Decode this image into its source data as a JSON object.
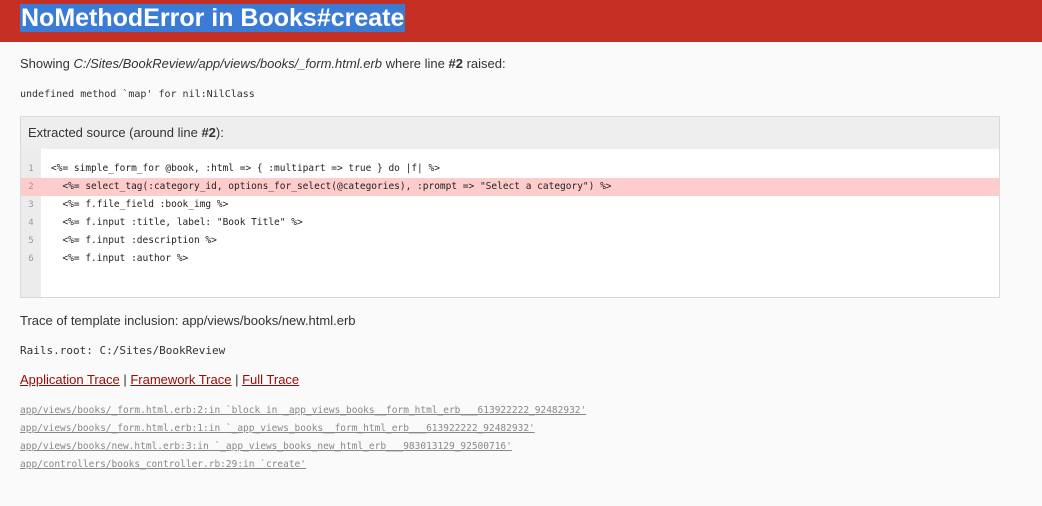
{
  "header": {
    "title": "NoMethodError in Books#create"
  },
  "showing": {
    "prefix": "Showing ",
    "path": "C:/Sites/BookReview/app/views/books/_form.html.erb",
    "middle": " where line ",
    "line": "#2",
    "suffix": " raised:"
  },
  "error_message": "undefined method `map' for nil:NilClass",
  "source": {
    "header_prefix": "Extracted source (around line ",
    "header_line": "#2",
    "header_suffix": "):",
    "highlight_line": 2,
    "lines": [
      {
        "number": "1",
        "code": "<%= simple_form_for @book, :html => { :multipart => true } do |f| %>"
      },
      {
        "number": "2",
        "code": "  <%= select_tag(:category_id, options_for_select(@categories), :prompt => \"Select a category\") %>"
      },
      {
        "number": "3",
        "code": "  <%= f.file_field :book_img %>"
      },
      {
        "number": "4",
        "code": "  <%= f.input :title, label: \"Book Title\" %>"
      },
      {
        "number": "5",
        "code": "  <%= f.input :description %>"
      },
      {
        "number": "6",
        "code": "  <%= f.input :author %>"
      }
    ]
  },
  "trace_inclusion": "Trace of template inclusion: app/views/books/new.html.erb",
  "rails_root": "Rails.root: C:/Sites/BookReview",
  "trace_links": {
    "application": "Application Trace",
    "framework": "Framework Trace",
    "full": "Full Trace",
    "separator": " | "
  },
  "frames": [
    "app/views/books/_form.html.erb:2:in `block in _app_views_books__form_html_erb___613922222_92482932'",
    "app/views/books/_form.html.erb:1:in `_app_views_books__form_html_erb___613922222_92482932'",
    "app/views/books/new.html.erb:3:in `_app_views_books_new_html_erb___983013129_92500716'",
    "app/controllers/books_controller.rb:29:in `create'"
  ],
  "colors": {
    "header_bg": "#c52f24",
    "title_highlight": "#3a7bd5",
    "error_line_bg": "#fcc",
    "link": "#980905"
  }
}
